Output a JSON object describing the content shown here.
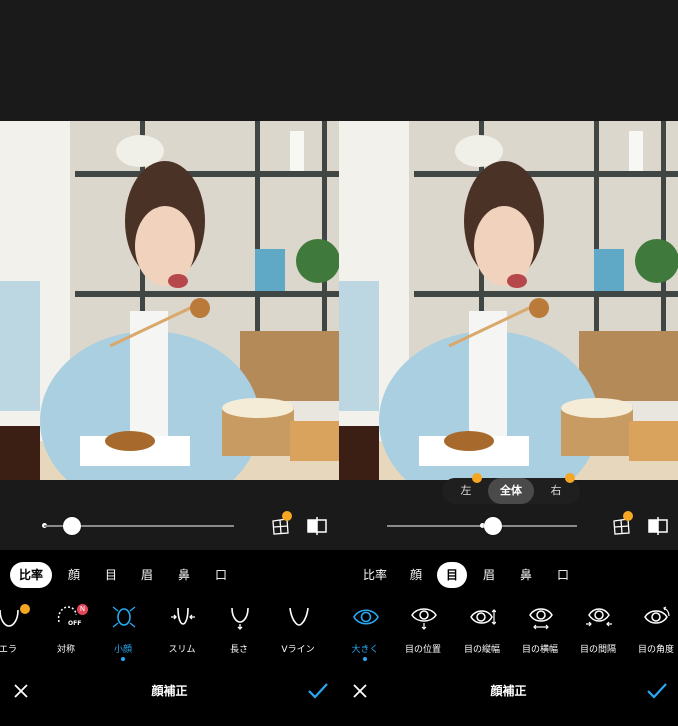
{
  "colors": {
    "accent": "#2aa8f2",
    "crown": "#f5a623",
    "new_badge": "#e4475a",
    "bg": "#000000",
    "panel": "#1a1a1a"
  },
  "left": {
    "slider": {
      "value_fraction": 0.16
    },
    "tabs": [
      {
        "label": "比率",
        "active": true
      },
      {
        "label": "顔",
        "active": false
      },
      {
        "label": "目",
        "active": false
      },
      {
        "label": "眉",
        "active": false
      },
      {
        "label": "鼻",
        "active": false
      },
      {
        "label": "口",
        "active": false
      }
    ],
    "features": [
      {
        "label": "エラ",
        "icon": "jaw-icon",
        "crown": true
      },
      {
        "label": "対称",
        "icon": "symmetry-off-icon",
        "badge": "N",
        "badge_sub": "OFF"
      },
      {
        "label": "小顔",
        "icon": "small-face-icon",
        "active": true
      },
      {
        "label": "スリム",
        "icon": "slim-icon"
      },
      {
        "label": "長さ",
        "icon": "length-icon"
      },
      {
        "label": "Vライン",
        "icon": "v-line-icon"
      }
    ],
    "title": "顔補正"
  },
  "right": {
    "side_options": [
      "左",
      "全体",
      "右"
    ],
    "side_selected": "全体",
    "slider": {
      "value_fraction": 0.55
    },
    "tabs": [
      {
        "label": "比率",
        "active": false
      },
      {
        "label": "顔",
        "active": false
      },
      {
        "label": "目",
        "active": true
      },
      {
        "label": "眉",
        "active": false
      },
      {
        "label": "鼻",
        "active": false
      },
      {
        "label": "口",
        "active": false
      }
    ],
    "features": [
      {
        "label": "大きく",
        "icon": "eye-icon",
        "active": true
      },
      {
        "label": "目の位置",
        "icon": "eye-position-icon"
      },
      {
        "label": "目の縦幅",
        "icon": "eye-height-icon"
      },
      {
        "label": "目の横幅",
        "icon": "eye-width-icon"
      },
      {
        "label": "目の間隔",
        "icon": "eye-distance-icon"
      },
      {
        "label": "目の角度",
        "icon": "eye-angle-icon"
      }
    ],
    "title": "顔補正"
  }
}
